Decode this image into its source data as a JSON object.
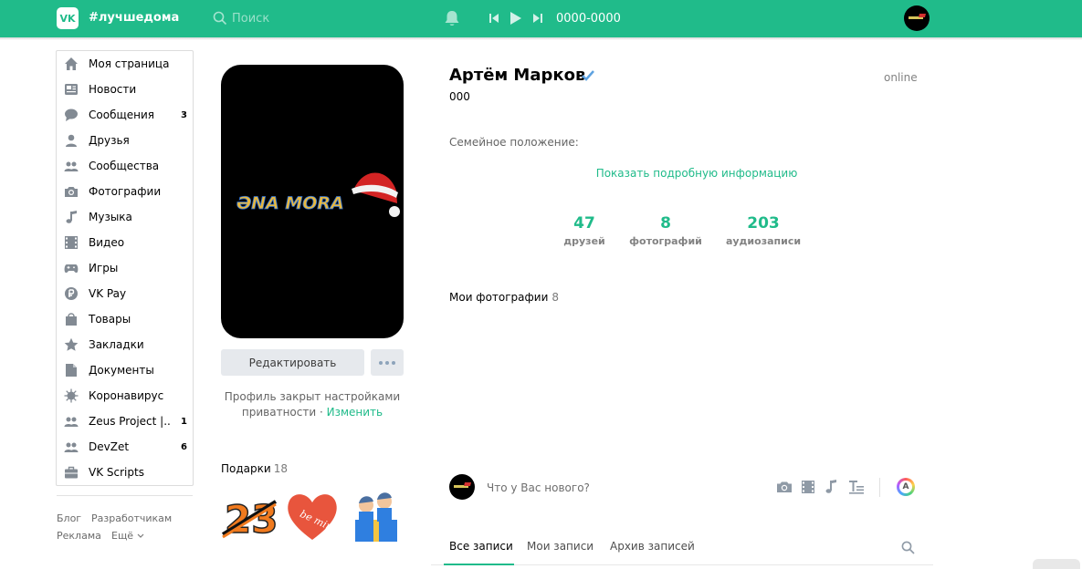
{
  "header": {
    "logo": "VK",
    "hashtag": "#лучшедома",
    "search_placeholder": "Поиск",
    "track_title": "0000-0000",
    "accent_color": "#20bb8a"
  },
  "menu": {
    "items": [
      {
        "label": "Моя страница",
        "icon": "home-icon",
        "count": ""
      },
      {
        "label": "Новости",
        "icon": "news-icon",
        "count": ""
      },
      {
        "label": "Сообщения",
        "icon": "messages-icon",
        "count": "3"
      },
      {
        "label": "Друзья",
        "icon": "friends-icon",
        "count": ""
      },
      {
        "label": "Сообщества",
        "icon": "groups-icon",
        "count": ""
      },
      {
        "label": "Фотографии",
        "icon": "camera-icon",
        "count": ""
      },
      {
        "label": "Музыка",
        "icon": "music-icon",
        "count": ""
      },
      {
        "label": "Видео",
        "icon": "video-icon",
        "count": ""
      },
      {
        "label": "Игры",
        "icon": "gamepad-icon",
        "count": ""
      },
      {
        "label": "VK Pay",
        "icon": "ruble-icon",
        "count": ""
      },
      {
        "label": "Товары",
        "icon": "bag-icon",
        "count": ""
      },
      {
        "label": "Закладки",
        "icon": "star-icon",
        "count": ""
      },
      {
        "label": "Документы",
        "icon": "document-icon",
        "count": ""
      },
      {
        "label": "Коронавирус",
        "icon": "virus-icon",
        "count": ""
      },
      {
        "label": "Zeus Project |..",
        "icon": "groups-icon",
        "count": "1"
      },
      {
        "label": "DevZet",
        "icon": "groups-icon",
        "count": "6"
      },
      {
        "label": "VK Scripts",
        "icon": "briefcase-icon",
        "count": ""
      }
    ],
    "footer": {
      "blog": "Блог",
      "developers": "Разработчикам",
      "ads": "Реклама",
      "more": "Ещё"
    }
  },
  "profile": {
    "photo_text": "ӘNA MORA",
    "edit_label": "Редактировать",
    "privacy_text": "Профиль закрыт настройками приватности ·",
    "privacy_link": "Изменить",
    "gifts_title": "Подарки",
    "gifts_count": "18",
    "name": "Артём Марков",
    "status": "000",
    "online": "online",
    "family_label": "Семейное положение:",
    "show_details": "Показать подробную информацию",
    "counters": [
      {
        "value": "47",
        "label": "друзей"
      },
      {
        "value": "8",
        "label": "фотографий"
      },
      {
        "value": "203",
        "label": "аудиозаписи"
      }
    ],
    "my_photos_title": "Мои фотографии",
    "my_photos_count": "8"
  },
  "composer": {
    "placeholder": "Что у Вас нового?",
    "ai_label": "A"
  },
  "tabs": [
    {
      "label": "Все записи"
    },
    {
      "label": "Мои записи"
    },
    {
      "label": "Архив записей"
    }
  ]
}
